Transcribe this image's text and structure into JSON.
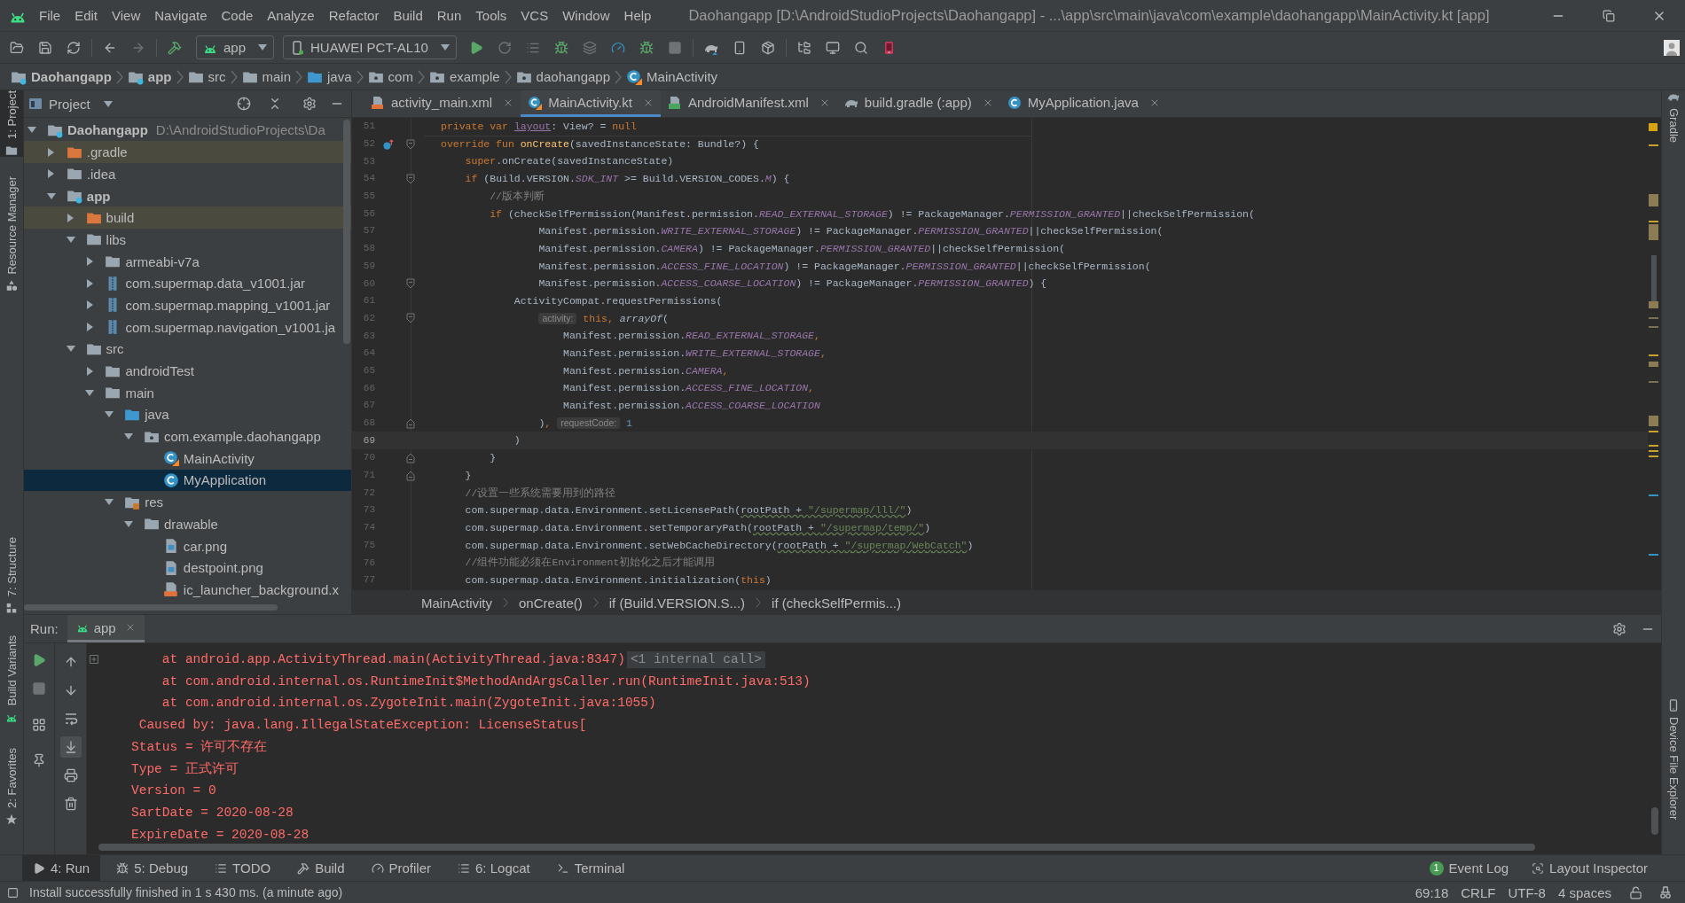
{
  "menu_bar": {
    "items": [
      "File",
      "Edit",
      "View",
      "Navigate",
      "Code",
      "Analyze",
      "Refactor",
      "Build",
      "Run",
      "Tools",
      "VCS",
      "Window",
      "Help"
    ],
    "window_title": "Daohangapp [D:\\AndroidStudioProjects\\Daohangapp] - ...\\app\\src\\main\\java\\com\\example\\daohangapp\\MainActivity.kt [app]"
  },
  "toolbar": {
    "run_configuration": "app",
    "device": "HUAWEI PCT-AL10"
  },
  "navigation_bar": [
    {
      "label": "Daohangapp",
      "kind": "module"
    },
    {
      "label": "app",
      "kind": "module"
    },
    {
      "label": "src",
      "kind": "folder"
    },
    {
      "label": "main",
      "kind": "folder"
    },
    {
      "label": "java",
      "kind": "source"
    },
    {
      "label": "com",
      "kind": "package"
    },
    {
      "label": "example",
      "kind": "package"
    },
    {
      "label": "daohangapp",
      "kind": "package"
    },
    {
      "label": "MainActivity",
      "kind": "kotlin"
    }
  ],
  "left_tool_strip": {
    "top": [
      {
        "label": "1: Project",
        "kind": "project",
        "selected": true
      },
      {
        "label": "Resource Manager",
        "kind": "resources",
        "selected": false
      }
    ],
    "middle": [
      {
        "label": "7: Structure",
        "kind": "structure",
        "selected": false
      }
    ],
    "bottom": [
      {
        "label": "Build Variants",
        "kind": "variants",
        "selected": false
      },
      {
        "label": "2: Favorites",
        "kind": "favorites",
        "selected": false
      }
    ]
  },
  "project_panel": {
    "title": "Project",
    "tree": [
      {
        "label": "Daohangapp",
        "kind": "module",
        "path": "D:\\AndroidStudioProjects\\Da",
        "expanded": true,
        "selected": false,
        "children": [
          {
            "label": ".gradle",
            "kind": "excluded",
            "expanded": false,
            "selected": false
          },
          {
            "label": ".idea",
            "kind": "folder",
            "expanded": false,
            "selected": false
          },
          {
            "label": "app",
            "kind": "module",
            "expanded": true,
            "selected": false,
            "children": [
              {
                "label": "build",
                "kind": "excluded",
                "expanded": false,
                "selected": false
              },
              {
                "label": "libs",
                "kind": "folder",
                "expanded": true,
                "selected": false,
                "children": [
                  {
                    "label": "armeabi-v7a",
                    "kind": "folder",
                    "expanded": false,
                    "selected": false
                  },
                  {
                    "label": "com.supermap.data_v1001.jar",
                    "kind": "jar",
                    "expanded": false,
                    "selected": false
                  },
                  {
                    "label": "com.supermap.mapping_v1001.jar",
                    "kind": "jar",
                    "expanded": false,
                    "selected": false
                  },
                  {
                    "label": "com.supermap.navigation_v1001.ja",
                    "kind": "jar",
                    "expanded": false,
                    "selected": false
                  }
                ]
              },
              {
                "label": "src",
                "kind": "folder",
                "expanded": true,
                "selected": false,
                "children": [
                  {
                    "label": "androidTest",
                    "kind": "folder",
                    "expanded": false,
                    "selected": false
                  },
                  {
                    "label": "main",
                    "kind": "folder",
                    "expanded": true,
                    "selected": false,
                    "children": [
                      {
                        "label": "java",
                        "kind": "source",
                        "expanded": true,
                        "selected": false,
                        "children": [
                          {
                            "label": "com.example.daohangapp",
                            "kind": "package",
                            "expanded": true,
                            "selected": false,
                            "children": [
                              {
                                "label": "MainActivity",
                                "kind": "kotlin",
                                "selected": false
                              },
                              {
                                "label": "MyApplication",
                                "kind": "java",
                                "selected": true
                              }
                            ]
                          }
                        ]
                      },
                      {
                        "label": "res",
                        "kind": "resources",
                        "expanded": true,
                        "selected": false,
                        "children": [
                          {
                            "label": "drawable",
                            "kind": "folder",
                            "expanded": true,
                            "selected": false,
                            "children": [
                              {
                                "label": "car.png",
                                "kind": "image",
                                "selected": false
                              },
                              {
                                "label": "destpoint.png",
                                "kind": "image",
                                "selected": false
                              },
                              {
                                "label": "ic_launcher_background.x",
                                "kind": "xml",
                                "selected": false
                              }
                            ]
                          }
                        ]
                      }
                    ]
                  }
                ]
              }
            ]
          }
        ]
      }
    ]
  },
  "editor": {
    "tabs": [
      {
        "label": "activity_main.xml",
        "kind": "xml",
        "selected": false
      },
      {
        "label": "MainActivity.kt",
        "kind": "kotlin",
        "selected": true
      },
      {
        "label": "AndroidManifest.xml",
        "kind": "manifest",
        "selected": false
      },
      {
        "label": "build.gradle (:app)",
        "kind": "gradle",
        "selected": false
      },
      {
        "label": "MyApplication.java",
        "kind": "java",
        "selected": false
      }
    ],
    "lines": [
      {
        "number": "51",
        "current": false,
        "override": false,
        "parts": [
          {
            "text": "private var ",
            "kind": "keyword"
          },
          {
            "text": "layout",
            "kind": "field"
          },
          {
            "text": ": View? = ",
            "kind": "plain"
          },
          {
            "text": "null",
            "kind": "keyword"
          }
        ]
      },
      {
        "number": "52",
        "current": false,
        "override": true,
        "fold_marker": {
          "kind": "start"
        },
        "parts": [
          {
            "text": "override fun ",
            "kind": "keyword"
          },
          {
            "text": "onCreate",
            "kind": "function"
          },
          {
            "text": "(savedInstanceState: Bundle?) {",
            "kind": "plain"
          }
        ]
      },
      {
        "number": "53",
        "current": false,
        "override": false,
        "parts": [
          {
            "text": "    super",
            "kind": "keyword"
          },
          {
            "text": ".onCreate(savedInstanceState)",
            "kind": "plain"
          }
        ]
      },
      {
        "number": "54",
        "current": false,
        "override": false,
        "fold_marker": {
          "kind": "start"
        },
        "parts": [
          {
            "text": "    if ",
            "kind": "keyword"
          },
          {
            "text": "(Build.VERSION.",
            "kind": "plain"
          },
          {
            "text": "SDK_INT",
            "kind": "constant"
          },
          {
            "text": " >= Build.VERSION_CODES.",
            "kind": "plain"
          },
          {
            "text": "M",
            "kind": "constant"
          },
          {
            "text": ") {",
            "kind": "plain"
          }
        ]
      },
      {
        "number": "55",
        "current": false,
        "override": false,
        "parts": [
          {
            "text": "        //版本判断",
            "kind": "comment"
          }
        ]
      },
      {
        "number": "56",
        "current": false,
        "override": false,
        "parts": [
          {
            "text": "        if ",
            "kind": "keyword"
          },
          {
            "text": "(checkSelfPermission(Manifest.permission.",
            "kind": "plain"
          },
          {
            "text": "READ_EXTERNAL_STORAGE",
            "kind": "constant"
          },
          {
            "text": ") != PackageManager.",
            "kind": "plain"
          },
          {
            "text": "PERMISSION_GRANTED",
            "kind": "constant"
          },
          {
            "text": "||checkSelfPermission(",
            "kind": "plain"
          }
        ]
      },
      {
        "number": "57",
        "current": false,
        "override": false,
        "parts": [
          {
            "text": "                Manifest.permission.",
            "kind": "plain"
          },
          {
            "text": "WRITE_EXTERNAL_STORAGE",
            "kind": "constant"
          },
          {
            "text": ") != PackageManager.",
            "kind": "plain"
          },
          {
            "text": "PERMISSION_GRANTED",
            "kind": "constant"
          },
          {
            "text": "||checkSelfPermission(",
            "kind": "plain"
          }
        ]
      },
      {
        "number": "58",
        "current": false,
        "override": false,
        "parts": [
          {
            "text": "                Manifest.permission.",
            "kind": "plain"
          },
          {
            "text": "CAMERA",
            "kind": "constant"
          },
          {
            "text": ") != PackageManager.",
            "kind": "plain"
          },
          {
            "text": "PERMISSION_GRANTED",
            "kind": "constant"
          },
          {
            "text": "||checkSelfPermission(",
            "kind": "plain"
          }
        ]
      },
      {
        "number": "59",
        "current": false,
        "override": false,
        "parts": [
          {
            "text": "                Manifest.permission.",
            "kind": "plain"
          },
          {
            "text": "ACCESS_FINE_LOCATION",
            "kind": "constant"
          },
          {
            "text": ") != PackageManager.",
            "kind": "plain"
          },
          {
            "text": "PERMISSION_GRANTED",
            "kind": "constant"
          },
          {
            "text": "||checkSelfPermission(",
            "kind": "plain"
          }
        ]
      },
      {
        "number": "60",
        "current": false,
        "override": false,
        "fold_marker": {
          "kind": "start"
        },
        "parts": [
          {
            "text": "                Manifest.permission.",
            "kind": "plain"
          },
          {
            "text": "ACCESS_COARSE_LOCATION",
            "kind": "constant"
          },
          {
            "text": ") != PackageManager.",
            "kind": "plain"
          },
          {
            "text": "PERMISSION_GRANTED",
            "kind": "constant"
          },
          {
            "text": ") {",
            "kind": "plain"
          }
        ]
      },
      {
        "number": "61",
        "current": false,
        "override": false,
        "parts": [
          {
            "text": "            ActivityCompat.requestPermissions(",
            "kind": "plain"
          }
        ]
      },
      {
        "number": "62",
        "current": false,
        "override": false,
        "fold_marker": {
          "kind": "start"
        },
        "parts": [
          {
            "text": "                activity:",
            "kind": "hint"
          },
          {
            "text": " this",
            "kind": "keyword"
          },
          {
            "text": ", ",
            "kind": "keyword"
          },
          {
            "text": "arrayOf",
            "kind": "italic"
          },
          {
            "text": "(",
            "kind": "plain"
          }
        ]
      },
      {
        "number": "63",
        "current": false,
        "override": false,
        "parts": [
          {
            "text": "                    Manifest.permission.",
            "kind": "plain"
          },
          {
            "text": "READ_EXTERNAL_STORAGE",
            "kind": "constant"
          },
          {
            "text": ",",
            "kind": "keyword"
          }
        ]
      },
      {
        "number": "64",
        "current": false,
        "override": false,
        "parts": [
          {
            "text": "                    Manifest.permission.",
            "kind": "plain"
          },
          {
            "text": "WRITE_EXTERNAL_STORAGE",
            "kind": "constant"
          },
          {
            "text": ",",
            "kind": "keyword"
          }
        ]
      },
      {
        "number": "65",
        "current": false,
        "override": false,
        "parts": [
          {
            "text": "                    Manifest.permission.",
            "kind": "plain"
          },
          {
            "text": "CAMERA",
            "kind": "constant"
          },
          {
            "text": ",",
            "kind": "keyword"
          }
        ]
      },
      {
        "number": "66",
        "current": false,
        "override": false,
        "parts": [
          {
            "text": "                    Manifest.permission.",
            "kind": "plain"
          },
          {
            "text": "ACCESS_FINE_LOCATION",
            "kind": "constant"
          },
          {
            "text": ",",
            "kind": "keyword"
          }
        ]
      },
      {
        "number": "67",
        "current": false,
        "override": false,
        "parts": [
          {
            "text": "                    Manifest.permission.",
            "kind": "plain"
          },
          {
            "text": "ACCESS_COARSE_LOCATION",
            "kind": "constant"
          }
        ]
      },
      {
        "number": "68",
        "current": false,
        "override": false,
        "fold_marker": {
          "kind": "end"
        },
        "parts": [
          {
            "text": "                )",
            "kind": "plain"
          },
          {
            "text": ", ",
            "kind": "keyword"
          },
          {
            "text": "requestCode:",
            "kind": "hint"
          },
          {
            "text": " 1",
            "kind": "number"
          }
        ]
      },
      {
        "number": "69",
        "current": true,
        "override": false,
        "parts": [
          {
            "text": "            )",
            "kind": "plain"
          }
        ]
      },
      {
        "number": "70",
        "current": false,
        "override": false,
        "fold_marker": {
          "kind": "end"
        },
        "parts": [
          {
            "text": "        }",
            "kind": "plain"
          }
        ]
      },
      {
        "number": "71",
        "current": false,
        "override": false,
        "fold_marker": {
          "kind": "end"
        },
        "parts": [
          {
            "text": "    }",
            "kind": "plain"
          }
        ]
      },
      {
        "number": "72",
        "current": false,
        "override": false,
        "parts": [
          {
            "text": "    //设置一些系统需要用到的路径",
            "kind": "comment"
          }
        ]
      },
      {
        "number": "73",
        "current": false,
        "override": false,
        "parts": [
          {
            "text": "    com.supermap.data.Environment.setLicensePath(",
            "kind": "plain"
          },
          {
            "text": "rootPath + ",
            "kind": "typo"
          },
          {
            "text": "\"/supermap/lll/\"",
            "kind": "typostring"
          },
          {
            "text": ")",
            "kind": "plain"
          }
        ]
      },
      {
        "number": "74",
        "current": false,
        "override": false,
        "parts": [
          {
            "text": "    com.supermap.data.Environment.setTemporaryPath(",
            "kind": "plain"
          },
          {
            "text": "rootPath + ",
            "kind": "typo"
          },
          {
            "text": "\"/supermap/temp/\"",
            "kind": "typostring"
          },
          {
            "text": ")",
            "kind": "plain"
          }
        ]
      },
      {
        "number": "75",
        "current": false,
        "override": false,
        "parts": [
          {
            "text": "    com.supermap.data.Environment.setWebCacheDirectory(",
            "kind": "plain"
          },
          {
            "text": "rootPath + ",
            "kind": "typo"
          },
          {
            "text": "\"/supermap/WebCatch\"",
            "kind": "typostring"
          },
          {
            "text": ")",
            "kind": "plain"
          }
        ]
      },
      {
        "number": "76",
        "current": false,
        "override": false,
        "parts": [
          {
            "text": "    //组件功能必须在Environment初始化之后才能调用",
            "kind": "comment"
          }
        ]
      },
      {
        "number": "77",
        "current": false,
        "override": false,
        "parts": [
          {
            "text": "    com.supermap.data.Environment.initialization(",
            "kind": "plain"
          },
          {
            "text": "this",
            "kind": "keyword"
          },
          {
            "text": ")",
            "kind": "plain"
          }
        ]
      }
    ],
    "breadcrumbs": [
      "MainActivity",
      "onCreate()",
      "if (Build.VERSION.S...)",
      "if (checkSelfPermis...)"
    ]
  },
  "run_panel": {
    "title": "Run:",
    "tabs": [
      {
        "label": "app",
        "selected": true
      }
    ],
    "scroll_to_end_on": true,
    "console": [
      {
        "text": "    at android.app.ActivityThread.main(ActivityThread.java:8347)",
        "badge": "<1 internal call>"
      },
      {
        "text": "    at com.android.internal.os.RuntimeInit$MethodAndArgsCaller.run(RuntimeInit.java:513)"
      },
      {
        "text": "    at com.android.internal.os.ZygoteInit.main(ZygoteInit.java:1055)"
      },
      {
        "text": " Caused by: java.lang.IllegalStateException: LicenseStatus["
      },
      {
        "text": "Status = 许可不存在"
      },
      {
        "text": "Type = 正式许可"
      },
      {
        "text": "Version = 0"
      },
      {
        "text": "SartDate = 2020-08-28"
      },
      {
        "text": "ExpireDate = 2020-08-28"
      }
    ]
  },
  "right_tool_strip": {
    "top": [
      {
        "label": "Gradle",
        "kind": "gradle",
        "selected": false
      }
    ],
    "bottom": [
      {
        "label": "Device File Explorer",
        "kind": "device",
        "selected": false
      }
    ]
  },
  "bottom_tool_bar": {
    "left": [
      {
        "label": "4: Run",
        "kind": "run",
        "selected": true
      },
      {
        "label": "5: Debug",
        "kind": "debug",
        "selected": false
      },
      {
        "label": "TODO",
        "kind": "todo",
        "selected": false
      },
      {
        "label": "Build",
        "kind": "build",
        "selected": false
      },
      {
        "label": "Profiler",
        "kind": "profiler",
        "selected": false
      },
      {
        "label": "6: Logcat",
        "kind": "logcat",
        "selected": false
      },
      {
        "label": "Terminal",
        "kind": "terminal",
        "selected": false
      }
    ],
    "right": [
      {
        "label": "Event Log",
        "kind": "events",
        "count": "1",
        "selected": false
      },
      {
        "label": "Layout Inspector",
        "kind": "inspector",
        "selected": false
      }
    ]
  },
  "status_bar": {
    "message": "Install successfully finished in 1 s 430 ms. (a minute ago)",
    "items": [
      "69:18",
      "CRLF",
      "UTF-8",
      "4 spaces"
    ]
  }
}
